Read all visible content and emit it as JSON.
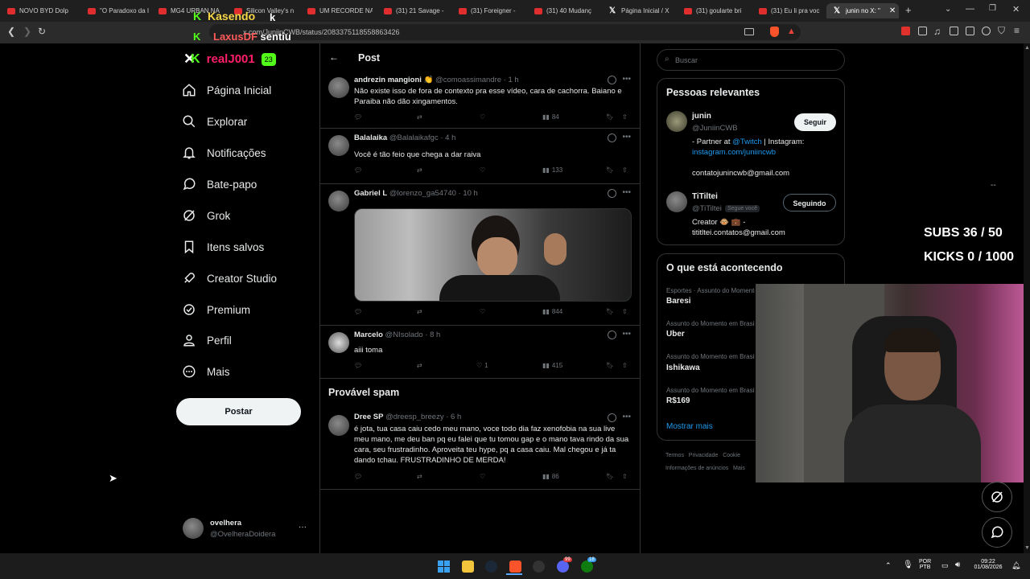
{
  "browser": {
    "tabs": [
      {
        "label": "NOVO BYD Dolp",
        "icon": "youtube-icon"
      },
      {
        "label": "\"O Paradoxo da I",
        "icon": "youtube-icon"
      },
      {
        "label": "MG4 URBAN NA",
        "icon": "youtube-icon"
      },
      {
        "label": "Silicon Valley's n",
        "icon": "youtube-icon"
      },
      {
        "label": "UM RECORDE NA",
        "icon": "youtube-icon"
      },
      {
        "label": "(31) 21 Savage -",
        "icon": "youtube-icon"
      },
      {
        "label": "(31) Foreigner -",
        "icon": "youtube-icon"
      },
      {
        "label": "(31) 40 Mudanç",
        "icon": "youtube-icon"
      },
      {
        "label": "Página Inicial / X",
        "icon": "x-icon"
      },
      {
        "label": "(31) goularte bri",
        "icon": "youtube-icon"
      },
      {
        "label": "(31) Eu li pra voc",
        "icon": "youtube-icon"
      },
      {
        "label": "junin no X: \"",
        "icon": "x-icon"
      }
    ],
    "url": "x.com/JuniinCWB/status/2083375118558863426"
  },
  "overlay": {
    "chat_user1": "Kasendo",
    "chat_user1_badge": "K",
    "chat_user2": "LaxusDF",
    "chat_user2_msg": "sentiu",
    "subs": "SUBS 36 / 50",
    "kicks": "KICKS 0 / 1000",
    "colors": {
      "kick_green": "#53fc18",
      "brand_pink": "#ff1e6a"
    }
  },
  "sidebar": {
    "brand": "realJ001",
    "brand_badge": "23",
    "items": [
      {
        "label": "Página Inicial",
        "icon": "home-icon"
      },
      {
        "label": "Explorar",
        "icon": "search-icon"
      },
      {
        "label": "Notificações",
        "icon": "bell-icon"
      },
      {
        "label": "Bate-papo",
        "icon": "chat-icon"
      },
      {
        "label": "Grok",
        "icon": "grok-icon"
      },
      {
        "label": "Itens salvos",
        "icon": "bookmark-icon"
      },
      {
        "label": "Creator Studio",
        "icon": "rocket-icon"
      },
      {
        "label": "Premium",
        "icon": "verified-icon"
      },
      {
        "label": "Perfil",
        "icon": "person-icon"
      },
      {
        "label": "Mais",
        "icon": "more-circle-icon"
      }
    ],
    "post_button": "Postar",
    "account": {
      "name": "ovelhera",
      "handle": "@OvelheraDoidera",
      "more": "···"
    }
  },
  "feed": {
    "header": "Post",
    "tweets": [
      {
        "name": "andrezin mangioni 👏",
        "handle": "@comoassimandre",
        "time": "· 1 h",
        "text": "Não existe isso de fora de contexto pra esse vídeo, cara de cachorra. Baiano e Paraiba não dão xingamentos.",
        "likes": "",
        "views": "84"
      },
      {
        "name": "Balalaika",
        "handle": "@Balalaikafgc",
        "time": "· 4 h",
        "text": "Você é tão feio que chega a dar raiva",
        "likes": "",
        "views": "133"
      },
      {
        "name": "Gabriel L",
        "handle": "@lorenzo_ga54740",
        "time": "· 10 h",
        "text": "",
        "likes": "",
        "views": "844"
      },
      {
        "name": "Marcelo",
        "handle": "@NIsolado",
        "time": "· 8 h",
        "text": "aiii toma",
        "likes": "1",
        "views": "415"
      }
    ],
    "spam_header": "Provável spam",
    "spam_tweet": {
      "name": "Dree SP",
      "handle": "@dreesp_breezy",
      "time": "· 6 h",
      "text": "é jota, tua casa caiu cedo meu mano, voce todo dia faz xenofobia na sua live meu mano, me deu ban pq eu falei que tu tomou gap e o mano tava rindo da sua cara, seu frustradinho. Aproveita teu hype, pq a casa caiu. Mal chegou e já ta dando tchau. FRUSTRADINHO DE MERDA!",
      "views": "86"
    }
  },
  "right": {
    "search_placeholder": "Buscar",
    "relevant_title": "Pessoas relevantes",
    "person1": {
      "name": "junin",
      "handle": "@JuniinCWB",
      "button": "Seguir",
      "bio1": "- Partner at ",
      "bio_link1": "@Twitch",
      "bio2": " | Instagram:",
      "bio_link2": "instagram.com/juniincwb",
      "bio3": "contatojunincwb@gmail.com"
    },
    "person2": {
      "name": "TiTiltei",
      "handle": "@TiTiltei",
      "follows_you": "Segue você",
      "button": "Seguindo",
      "bio1": "Creator 🐵 💼 -",
      "bio2": "tititltei.contatos@gmail.com"
    },
    "trends_title": "O que está acontecendo",
    "trends": [
      {
        "sub": "Esportes · Assunto do Momento",
        "name": "Baresi"
      },
      {
        "sub": "Assunto do Momento em Brasil",
        "name": "Uber"
      },
      {
        "sub": "Assunto do Momento em Brasil",
        "name": "Ishikawa"
      },
      {
        "sub": "Assunto do Momento em Brasil",
        "name": "R$169"
      }
    ],
    "show_more": "Mostrar mais",
    "footer1": "Termos   Privacidade   Cookie",
    "footer2": "Informações de anúncios   Mais"
  },
  "taskbar": {
    "lang1": "POR",
    "lang2": "PTB",
    "time": "09:22",
    "date": "01/08/2026",
    "badge1": "99",
    "badge2": "18"
  }
}
